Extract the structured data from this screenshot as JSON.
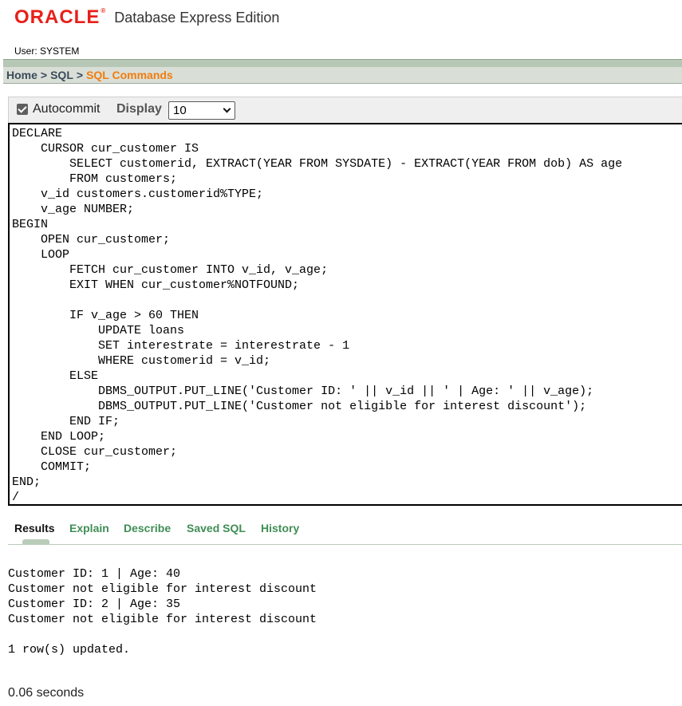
{
  "header": {
    "logo_text": "ORACLE",
    "logo_reg": "®",
    "product": "Database Express Edition",
    "user_line": "User: SYSTEM"
  },
  "breadcrumb": {
    "home": "Home",
    "sql": "SQL",
    "current": "SQL Commands",
    "separator": ">"
  },
  "toolbar": {
    "autocommit_label": "Autocommit",
    "autocommit_checked": true,
    "display_label": "Display",
    "display_value": "10"
  },
  "editor": {
    "lines": [
      "DECLARE",
      "    CURSOR cur_customer IS",
      "        SELECT customerid, EXTRACT(YEAR FROM SYSDATE) - EXTRACT(YEAR FROM dob) AS age",
      "        FROM customers;",
      "    v_id customers.customerid%TYPE;",
      "    v_age NUMBER;",
      "BEGIN",
      "    OPEN cur_customer;",
      "    LOOP",
      "        FETCH cur_customer INTO v_id, v_age;",
      "        EXIT WHEN cur_customer%NOTFOUND;",
      "",
      "        IF v_age > 60 THEN",
      "            UPDATE loans",
      "            SET interestrate = interestrate - 1",
      "            WHERE customerid = v_id;",
      "        ELSE",
      "            DBMS_OUTPUT.PUT_LINE('Customer ID: ' || v_id || ' | Age: ' || v_age);",
      "            DBMS_OUTPUT.PUT_LINE('Customer not eligible for interest discount');",
      "        END IF;",
      "    END LOOP;",
      "    CLOSE cur_customer;",
      "    COMMIT;",
      "END;",
      "/"
    ]
  },
  "tabs": [
    {
      "label": "Results",
      "active": true
    },
    {
      "label": "Explain",
      "active": false
    },
    {
      "label": "Describe",
      "active": false
    },
    {
      "label": "Saved SQL",
      "active": false
    },
    {
      "label": "History",
      "active": false
    }
  ],
  "results": {
    "lines": [
      "Customer ID: 1 | Age: 40",
      "Customer not eligible for interest discount",
      "Customer ID: 2 | Age: 35",
      "Customer not eligible for interest discount",
      "",
      "1 row(s) updated."
    ],
    "timing": "0.06 seconds"
  },
  "colors": {
    "brand_red": "#e8201a",
    "breadcrumb_current": "#f27c0f",
    "tab_link": "#3f8e55"
  }
}
